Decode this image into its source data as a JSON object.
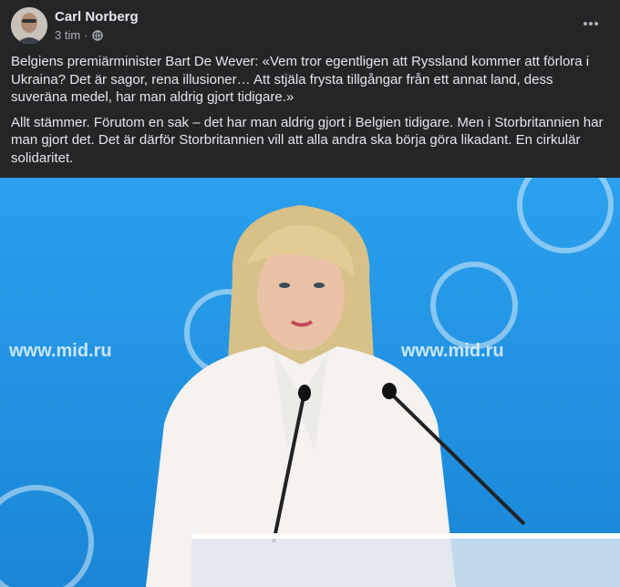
{
  "post": {
    "author": "Carl Norberg",
    "time": "3 tim",
    "separator": "·",
    "privacy_icon": "globe-icon",
    "more_icon": "more-options-icon",
    "paragraph1": "Belgiens premiärminister Bart De Wever: «Vem tror egentligen att Ryssland kommer att förlora i Ukraina? Det är sagor, rena illusioner… Att stjäla frysta tillgångar från ett annat land, dess suveräna medel, har man aldrig gjort tidigare.»",
    "paragraph2": "Allt stämmer. Förutom en sak – det har man aldrig gjort i Belgien tidigare. Men i Storbritannien har man gjort det. Det är därför Storbritannien vill att alla andra ska börja göra likadant. En cirkulär solidaritet."
  },
  "photo": {
    "backdrop_text_left": "www.mid.ru",
    "backdrop_text_right": "www.mid.ru",
    "backdrop_color": "#1f8fe0"
  }
}
